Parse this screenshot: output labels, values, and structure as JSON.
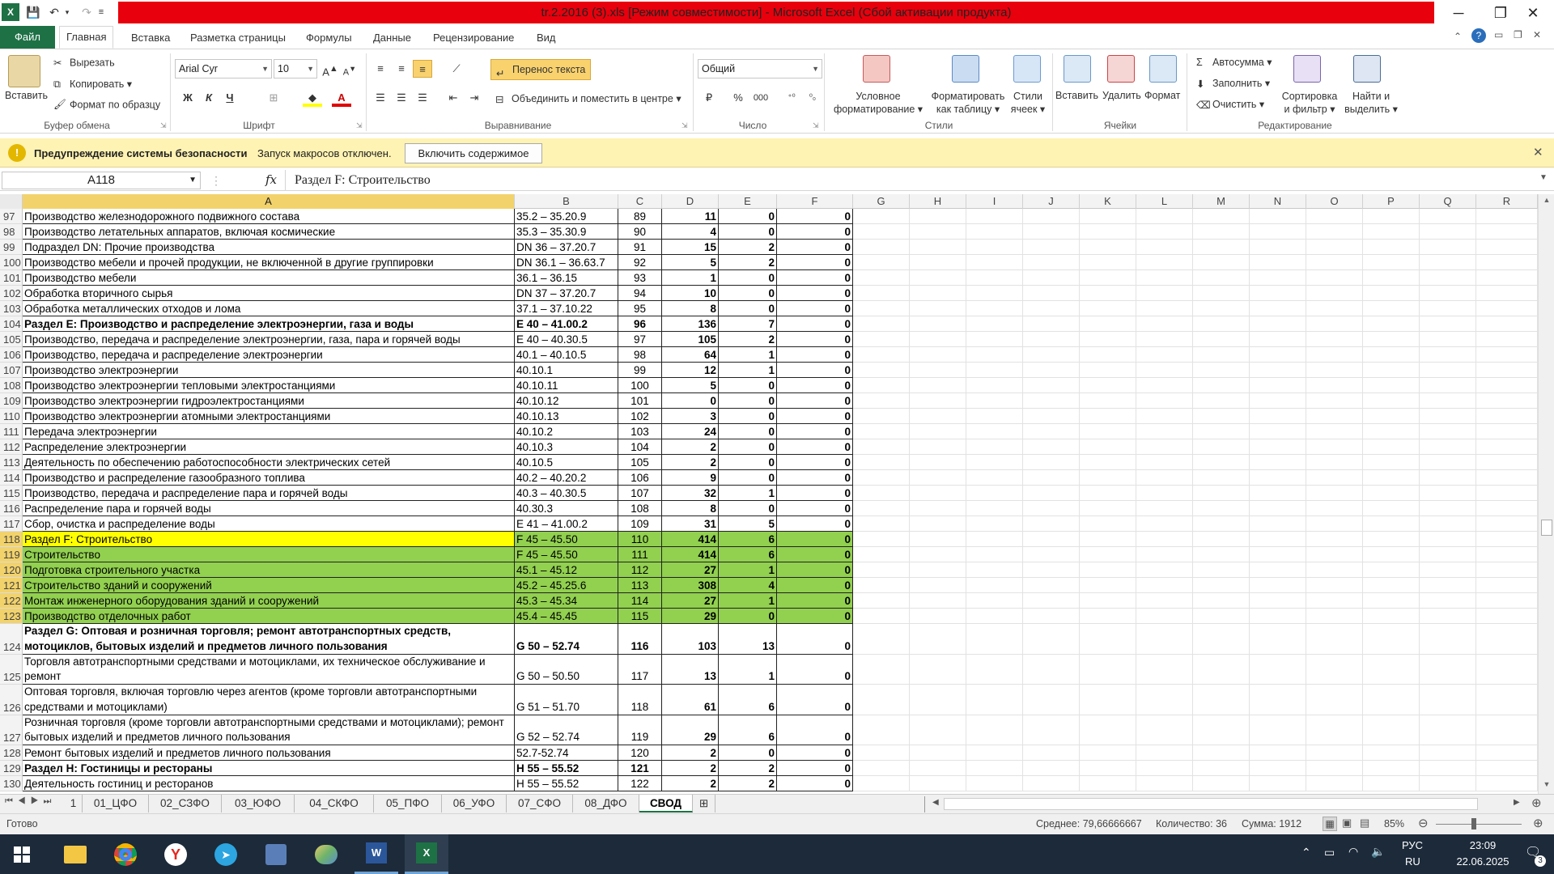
{
  "title": "tr.2.2016 (3).xls  [Режим совместимости] - Microsoft Excel (Сбой активации продукта)",
  "tabs": [
    "Главная",
    "Вставка",
    "Разметка страницы",
    "Формулы",
    "Данные",
    "Рецензирование",
    "Вид"
  ],
  "file_tab": "Файл",
  "ribbon": {
    "paste": "Вставить",
    "cut": "Вырезать",
    "copy": "Копировать",
    "format_painter": "Формат по образцу",
    "clipboard_group": "Буфер обмена",
    "font_name": "Arial Cyr",
    "font_size": "10",
    "bold": "Ж",
    "italic": "К",
    "underline": "Ч",
    "font_group": "Шрифт",
    "wrap_text": "Перенос текста",
    "merge_center": "Объединить и поместить в центре",
    "align_group": "Выравнивание",
    "number_format": "Общий",
    "percent": "%",
    "thousands": "000",
    "number_group": "Число",
    "cond_format_1": "Условное",
    "cond_format_2": "форматирование",
    "format_table_1": "Форматировать",
    "format_table_2": "как таблицу",
    "cell_styles_1": "Стили",
    "cell_styles_2": "ячеек",
    "styles_group": "Стили",
    "insert": "Вставить",
    "delete": "Удалить",
    "format": "Формат",
    "cells_group": "Ячейки",
    "autosum": "Автосумма",
    "fill": "Заполнить",
    "clear": "Очистить",
    "sort_1": "Сортировка",
    "sort_2": "и фильтр",
    "find_1": "Найти и",
    "find_2": "выделить",
    "edit_group": "Редактирование"
  },
  "security": {
    "title": "Предупреждение системы безопасности",
    "message": "Запуск макросов отключен.",
    "button": "Включить содержимое"
  },
  "formula_bar": {
    "name_box": "A118",
    "fx": "fx",
    "content": "Раздел F: Строительство"
  },
  "columns": [
    "A",
    "B",
    "C",
    "D",
    "E",
    "F",
    "G",
    "H",
    "I",
    "J",
    "K",
    "L",
    "M",
    "N",
    "O",
    "P",
    "Q",
    "R"
  ],
  "rows": [
    {
      "n": "97",
      "a": "Производство железнодорожного подвижного состава",
      "b": "35.2 – 35.20.9",
      "c": "89",
      "d": "11",
      "e": "0",
      "f": "0"
    },
    {
      "n": "98",
      "a": "Производство летательных аппаратов, включая космические",
      "b": "35.3 – 35.30.9",
      "c": "90",
      "d": "4",
      "e": "0",
      "f": "0"
    },
    {
      "n": "99",
      "a": "Подраздел DN: Прочие  производства",
      "b": "DN 36 – 37.20.7",
      "c": "91",
      "d": "15",
      "e": "2",
      "f": "0"
    },
    {
      "n": "100",
      "a": "Производство мебели и прочей продукции, не включенной в другие группировки",
      "b": "DN 36.1 – 36.63.7",
      "c": "92",
      "d": "5",
      "e": "2",
      "f": "0"
    },
    {
      "n": "101",
      "a": "Производство мебели",
      "b": "36.1 – 36.15",
      "c": "93",
      "d": "1",
      "e": "0",
      "f": "0"
    },
    {
      "n": "102",
      "a": "Обработка вторичного сырья",
      "b": "DN 37 – 37.20.7",
      "c": "94",
      "d": "10",
      "e": "0",
      "f": "0"
    },
    {
      "n": "103",
      "a": "Обработка металлических отходов и лома",
      "b": "37.1 – 37.10.22",
      "c": "95",
      "d": "8",
      "e": "0",
      "f": "0"
    },
    {
      "n": "104",
      "a": "Раздел E: Производство и распределение электроэнергии, газа и воды",
      "b": "E 40 – 41.00.2",
      "c": "96",
      "d": "136",
      "e": "7",
      "f": "0",
      "bold": true
    },
    {
      "n": "105",
      "a": "Производство, передача и распределение электроэнергии, газа, пара и горячей воды",
      "b": "E 40 – 40.30.5",
      "c": "97",
      "d": "105",
      "e": "2",
      "f": "0"
    },
    {
      "n": "106",
      "a": "Производство, передача и распределение электроэнергии",
      "b": "40.1 – 40.10.5",
      "c": "98",
      "d": "64",
      "e": "1",
      "f": "0"
    },
    {
      "n": "107",
      "a": "Производство электроэнергии",
      "b": "40.10.1",
      "c": "99",
      "d": "12",
      "e": "1",
      "f": "0"
    },
    {
      "n": "108",
      "a": "Производство электроэнергии тепловыми электростанциями",
      "b": "40.10.11",
      "c": "100",
      "d": "5",
      "e": "0",
      "f": "0"
    },
    {
      "n": "109",
      "a": "Производство электроэнергии гидроэлектростанциями",
      "b": "40.10.12",
      "c": "101",
      "d": "0",
      "e": "0",
      "f": "0"
    },
    {
      "n": "110",
      "a": "Производство электроэнергии атомными электростанциями",
      "b": "40.10.13",
      "c": "102",
      "d": "3",
      "e": "0",
      "f": "0"
    },
    {
      "n": "111",
      "a": "Передача электроэнергии",
      "b": "40.10.2",
      "c": "103",
      "d": "24",
      "e": "0",
      "f": "0"
    },
    {
      "n": "112",
      "a": "Распределение электроэнергии",
      "b": "40.10.3",
      "c": "104",
      "d": "2",
      "e": "0",
      "f": "0"
    },
    {
      "n": "113",
      "a": "Деятельность по обеспечению работоспособности электрических сетей",
      "b": "40.10.5",
      "c": "105",
      "d": "2",
      "e": "0",
      "f": "0"
    },
    {
      "n": "114",
      "a": "Производство и распределение газообразного  топлива",
      "b": "40.2 – 40.20.2",
      "c": "106",
      "d": "9",
      "e": "0",
      "f": "0"
    },
    {
      "n": "115",
      "a": "Производство, передача и распределение пара и горячей воды",
      "b": "40.3 – 40.30.5",
      "c": "107",
      "d": "32",
      "e": "1",
      "f": "0"
    },
    {
      "n": "116",
      "a": "Распределение пара и горячей воды",
      "b": "40.30.3",
      "c": "108",
      "d": "8",
      "e": "0",
      "f": "0"
    },
    {
      "n": "117",
      "a": "Сбор, очистка и распределение воды",
      "b": "E 41 – 41.00.2",
      "c": "109",
      "d": "31",
      "e": "5",
      "f": "0"
    },
    {
      "n": "118",
      "a": "Раздел F: Строительство",
      "b": "F 45 – 45.50",
      "c": "110",
      "d": "414",
      "e": "6",
      "f": "0",
      "hl": "yellow"
    },
    {
      "n": "119",
      "a": "Строительство",
      "b": "F 45 – 45.50",
      "c": "111",
      "d": "414",
      "e": "6",
      "f": "0",
      "hl": "green"
    },
    {
      "n": "120",
      "a": "Подготовка строительного участка",
      "b": "45.1 – 45.12",
      "c": "112",
      "d": "27",
      "e": "1",
      "f": "0",
      "hl": "green"
    },
    {
      "n": "121",
      "a": "Строительство зданий и сооружений",
      "b": "45.2 – 45.25.6",
      "c": "113",
      "d": "308",
      "e": "4",
      "f": "0",
      "hl": "green"
    },
    {
      "n": "122",
      "a": "Монтаж инженерного оборудования зданий и сооружений",
      "b": "45.3 – 45.34",
      "c": "114",
      "d": "27",
      "e": "1",
      "f": "0",
      "hl": "green"
    },
    {
      "n": "123",
      "a": "Производство отделочных работ",
      "b": "45.4 – 45.45",
      "c": "115",
      "d": "29",
      "e": "0",
      "f": "0",
      "hl": "green"
    },
    {
      "n": "124",
      "a": "Раздел G: Оптовая и розничная торговля; ремонт автотранспортных средств, мотоциклов, бытовых изделий и предметов личного пользования",
      "b": "G 50 – 52.74",
      "c": "116",
      "d": "103",
      "e": "13",
      "f": "0",
      "bold": true,
      "tall": true
    },
    {
      "n": "125",
      "a": "Торговля автотранспортными средствами и мотоциклами, их техническое обслуживание и ремонт",
      "b": "G 50 – 50.50",
      "c": "117",
      "d": "13",
      "e": "1",
      "f": "0",
      "tall": true
    },
    {
      "n": "126",
      "a": "Оптовая торговля, включая торговлю через агентов (кроме торговли автотранспортными средствами и мотоциклами)",
      "b": "G 51 – 51.70",
      "c": "118",
      "d": "61",
      "e": "6",
      "f": "0",
      "tall": true
    },
    {
      "n": "127",
      "a": "Розничная торговля (кроме торговли автотранспортными средствами и мотоциклами); ремонт бытовых изделий и предметов личного пользования",
      "b": "G 52 – 52.74",
      "c": "119",
      "d": "29",
      "e": "6",
      "f": "0",
      "tall": true
    },
    {
      "n": "128",
      "a": "Ремонт бытовых изделий и предметов личного пользования",
      "b": "52.7-52.74",
      "c": "120",
      "d": "2",
      "e": "0",
      "f": "0"
    },
    {
      "n": "129",
      "a": "Раздел H: Гостиницы и рестораны",
      "b": "H 55 – 55.52",
      "c": "121",
      "d": "2",
      "e": "2",
      "f": "0",
      "bold": true
    },
    {
      "n": "130",
      "a": "Деятельность гостиниц и ресторанов",
      "b": "H 55 – 55.52",
      "c": "122",
      "d": "2",
      "e": "2",
      "f": "0"
    }
  ],
  "sheet_tabs": [
    "1",
    "01_ЦФО",
    "02_СЗФО",
    "03_ЮФО",
    "04_СКФО",
    "05_ПФО",
    "06_УФО",
    "07_СФО",
    "08_ДФО",
    "СВОД"
  ],
  "active_sheet": "СВОД",
  "status": {
    "ready": "Готово",
    "average": "Среднее: 79,66666667",
    "count": "Количество: 36",
    "sum": "Сумма: 1912",
    "zoom": "85%"
  },
  "taskbar": {
    "lang_top": "РУС",
    "lang_bottom": "RU",
    "time": "23:09",
    "date": "22.06.2025",
    "notif": "3"
  }
}
